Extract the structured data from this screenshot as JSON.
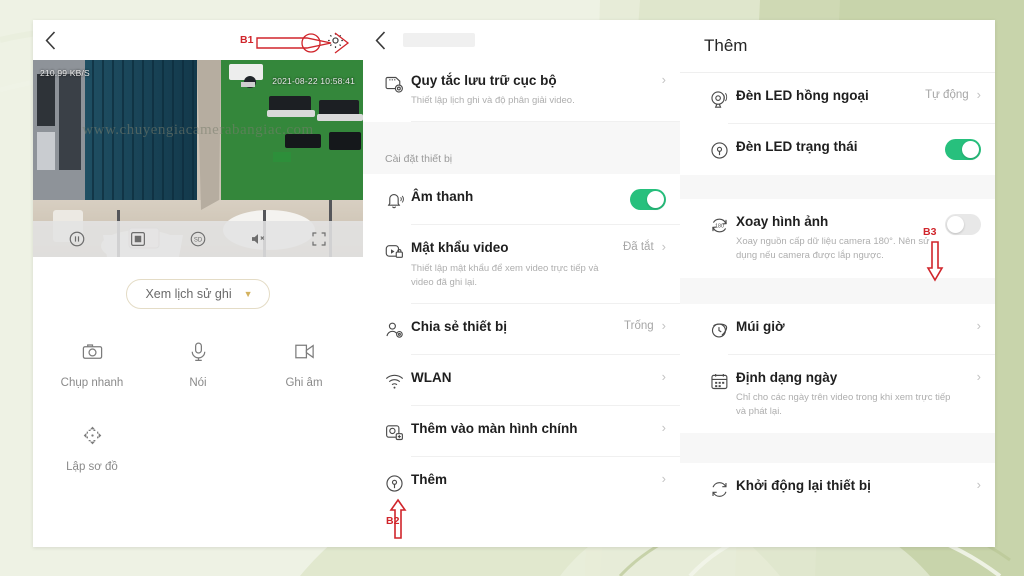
{
  "theme": {
    "accent_green": "#27c07d",
    "annotation_red": "#d0252b",
    "pill_border": "#e4dcc6",
    "background_green": "#cfd9b4"
  },
  "live_panel": {
    "back_icon": "chevron-left-icon",
    "settings_icon": "gear-icon",
    "video": {
      "bitrate_osd": "210.99 KB/S",
      "timestamp_osd": "2021-08-22 10:58:41",
      "watermark": "www.chuyengiacamerabangiac.com"
    },
    "player_controls": [
      {
        "name": "pause-button",
        "icon": "pause-circle-icon"
      },
      {
        "name": "stop-record-button",
        "icon": "stop-square-icon"
      },
      {
        "name": "resolution-button",
        "icon": "hd-circle-icon"
      },
      {
        "name": "mute-button",
        "icon": "speaker-mute-icon"
      },
      {
        "name": "fullscreen-button",
        "icon": "fullscreen-icon"
      }
    ],
    "history_button": {
      "label": "Xem lịch sử ghi",
      "caret": "chevron-down-icon"
    },
    "actions": [
      {
        "label": "Chụp nhanh",
        "icon": "camera-icon"
      },
      {
        "label": "Nói",
        "icon": "microphone-icon"
      },
      {
        "label": "Ghi âm",
        "icon": "video-record-icon"
      },
      {
        "label": "Lập sơ đồ",
        "icon": "pan-tilt-icon"
      }
    ]
  },
  "settings_panel": {
    "back_icon": "chevron-left-icon",
    "title_redacted": true,
    "storage_row": {
      "title": "Quy tắc lưu trữ cục bộ",
      "subtitle": "Thiết lập lịch ghi và độ phân giải video.",
      "icon": "sd-card-icon",
      "chevron": "chevron-right-icon"
    },
    "section_header": "Cài đặt thiết bị",
    "rows": [
      {
        "title": "Âm thanh",
        "subtitle": "",
        "icon": "bell-sound-icon",
        "control": "toggle",
        "toggle_on": true,
        "value": ""
      },
      {
        "title": "Mật khẩu video",
        "subtitle": "Thiết lập mật khẩu để xem video trực tiếp và video đã ghi lại.",
        "icon": "video-lock-icon",
        "control": "value",
        "value": "Đã tắt"
      },
      {
        "title": "Chia sẻ thiết bị",
        "subtitle": "",
        "icon": "share-user-icon",
        "control": "value",
        "value": "Trống"
      },
      {
        "title": "WLAN",
        "subtitle": "",
        "icon": "wifi-icon",
        "control": "chevron",
        "value": ""
      },
      {
        "title": "Thêm vào màn hình chính",
        "subtitle": "",
        "icon": "add-to-homescreen-icon",
        "control": "chevron",
        "value": ""
      },
      {
        "title": "Thêm",
        "subtitle": "",
        "icon": "more-settings-icon",
        "control": "chevron",
        "value": ""
      }
    ]
  },
  "more_panel": {
    "title": "Thêm",
    "rows": [
      {
        "title": "Đèn LED hồng ngoại",
        "subtitle": "",
        "icon": "infrared-led-icon",
        "control": "value",
        "value": "Tự động"
      },
      {
        "title": "Đèn LED trạng thái",
        "subtitle": "",
        "icon": "status-led-icon",
        "control": "toggle",
        "toggle_on": true,
        "value": ""
      },
      {
        "title": "Xoay hình ảnh",
        "subtitle": "Xoay nguồn cấp dữ liệu camera 180°. Nên sử dụng nếu camera được lắp ngược.",
        "icon": "rotate-180-icon",
        "control": "toggle",
        "toggle_on": false,
        "value": ""
      },
      {
        "title": "Múi giờ",
        "subtitle": "",
        "icon": "timezone-globe-icon",
        "control": "chevron",
        "value": ""
      },
      {
        "title": "Định dạng ngày",
        "subtitle": "Chỉ cho các ngày trên video trong khi xem trực tiếp và phát lại.",
        "icon": "calendar-icon",
        "control": "chevron",
        "value": ""
      },
      {
        "title": "Khởi động lại thiết bị",
        "subtitle": "",
        "icon": "restart-icon",
        "control": "chevron",
        "value": ""
      }
    ]
  },
  "annotations": [
    {
      "label": "B1",
      "points_to": "gear-icon in live panel top bar"
    },
    {
      "label": "B2",
      "points_to": "Thêm row icon in settings panel"
    },
    {
      "label": "B3",
      "points_to": "Xoay hình ảnh toggle in more panel"
    }
  ]
}
